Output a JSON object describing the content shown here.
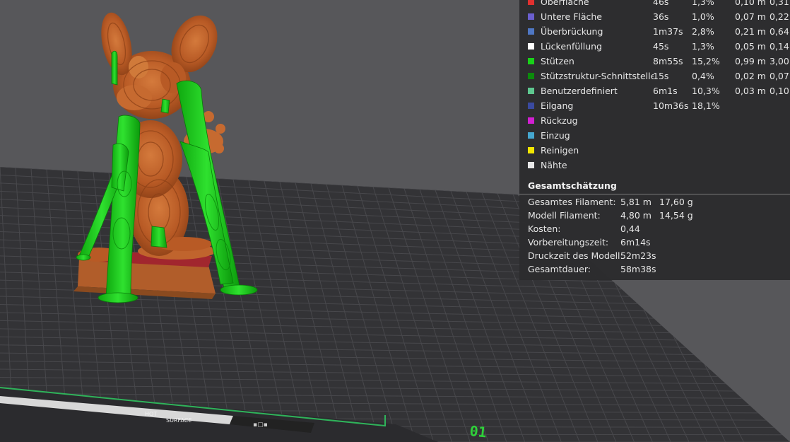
{
  "legend": {
    "rows": [
      {
        "name": "Oberfläche",
        "time": "46s",
        "percent": "1,3%",
        "length": "0,10 m",
        "weight": "0,31",
        "color": "#e0302f"
      },
      {
        "name": "Untere Fläche",
        "time": "36s",
        "percent": "1,0%",
        "length": "0,07 m",
        "weight": "0,22",
        "color": "#6b5fcf"
      },
      {
        "name": "Überbrückung",
        "time": "1m37s",
        "percent": "2,8%",
        "length": "0,21 m",
        "weight": "0,64",
        "color": "#4f77c4"
      },
      {
        "name": "Lückenfüllung",
        "time": "45s",
        "percent": "1,3%",
        "length": "0,05 m",
        "weight": "0,14",
        "color": "#ffffff"
      },
      {
        "name": "Stützen",
        "time": "8m55s",
        "percent": "15,2%",
        "length": "0,99 m",
        "weight": "3,00",
        "color": "#19d119"
      },
      {
        "name": "Stützstruktur-Schnittstelle",
        "time": "15s",
        "percent": "0,4%",
        "length": "0,02 m",
        "weight": "0,07",
        "color": "#0c8a0c"
      },
      {
        "name": "Benutzerdefiniert",
        "time": "6m1s",
        "percent": "10,3%",
        "length": "0,03 m",
        "weight": "0,10",
        "color": "#5ec78f"
      },
      {
        "name": "Eilgang",
        "time": "10m36s",
        "percent": "18,1%",
        "length": "",
        "weight": "",
        "color": "#3a4aa0"
      },
      {
        "name": "Rückzug",
        "time": "",
        "percent": "",
        "length": "",
        "weight": "",
        "color": "#d21fd2"
      },
      {
        "name": "Einzug",
        "time": "",
        "percent": "",
        "length": "",
        "weight": "",
        "color": "#45a7cf"
      },
      {
        "name": "Reinigen",
        "time": "",
        "percent": "",
        "length": "",
        "weight": "",
        "color": "#f2e600"
      },
      {
        "name": "Nähte",
        "time": "",
        "percent": "",
        "length": "",
        "weight": "",
        "color": "#e8e8e8"
      }
    ]
  },
  "summary": {
    "title": "Gesamtschätzung",
    "rows": [
      {
        "label": "Gesamtes Filament:",
        "value": "5,81 m",
        "value2": "17,60 g"
      },
      {
        "label": "Modell Filament:",
        "value": "4,80 m",
        "value2": "14,54 g"
      },
      {
        "label": "Kosten:",
        "value": "0,44",
        "value2": ""
      },
      {
        "label": "Vorbereitungszeit:",
        "value": "6m14s",
        "value2": ""
      },
      {
        "label": "Druckzeit des Modell:",
        "value": "52m23s",
        "value2": ""
      },
      {
        "label": "Gesamtdauer:",
        "value": "58m38s",
        "value2": ""
      }
    ]
  },
  "plate": {
    "logo_text_line1": "HOT",
    "logo_text_line2": "SURFACE",
    "plate_number": "01"
  },
  "colors": {
    "background": "#57575a",
    "plate": "#333336",
    "grid_line": "#4a4a4e",
    "model_orange": "#c0642d",
    "support_green": "#19d119",
    "plate_edge_green": "#2fb35a"
  }
}
